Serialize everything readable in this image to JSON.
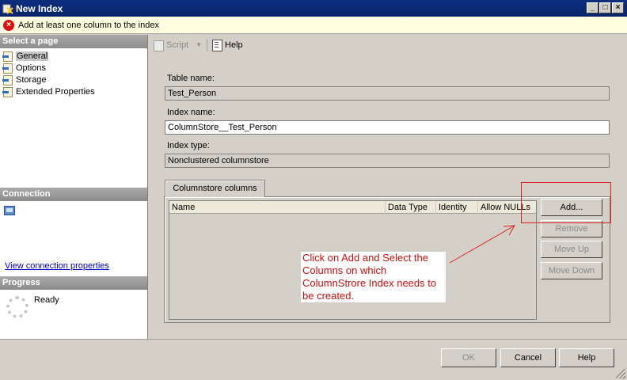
{
  "window": {
    "title": "New Index",
    "controls": [
      "_",
      "□",
      "×"
    ]
  },
  "error_bar": {
    "message": "Add at least one column to the index"
  },
  "left_panel": {
    "select_page_header": "Select a page",
    "pages": [
      {
        "label": "General",
        "selected": true
      },
      {
        "label": "Options",
        "selected": false
      },
      {
        "label": "Storage",
        "selected": false
      },
      {
        "label": "Extended Properties",
        "selected": false
      }
    ],
    "connection_header": "Connection",
    "connection_link": "View connection properties",
    "progress_header": "Progress",
    "progress_status": "Ready"
  },
  "toolbar": {
    "script_label": "Script",
    "help_label": "Help"
  },
  "form": {
    "table_name_label": "Table name:",
    "table_name_value": "Test_Person",
    "index_name_label": "Index name:",
    "index_name_value": "ColumnStore__Test_Person",
    "index_type_label": "Index type:",
    "index_type_value": "Nonclustered columnstore"
  },
  "tab": {
    "label": "Columnstore columns"
  },
  "grid": {
    "columns": [
      "Name",
      "Data Type",
      "Identity",
      "Allow NULLs"
    ],
    "rows": []
  },
  "side_buttons": {
    "add": "Add...",
    "remove": "Remove",
    "move_up": "Move Up",
    "move_down": "Move Down"
  },
  "annotation": {
    "note": "Click on Add and Select the Columns on which ColumnStrore Index needs to be created.",
    "color": "#e02020"
  },
  "dialog_buttons": {
    "ok": "OK",
    "cancel": "Cancel",
    "help": "Help"
  }
}
